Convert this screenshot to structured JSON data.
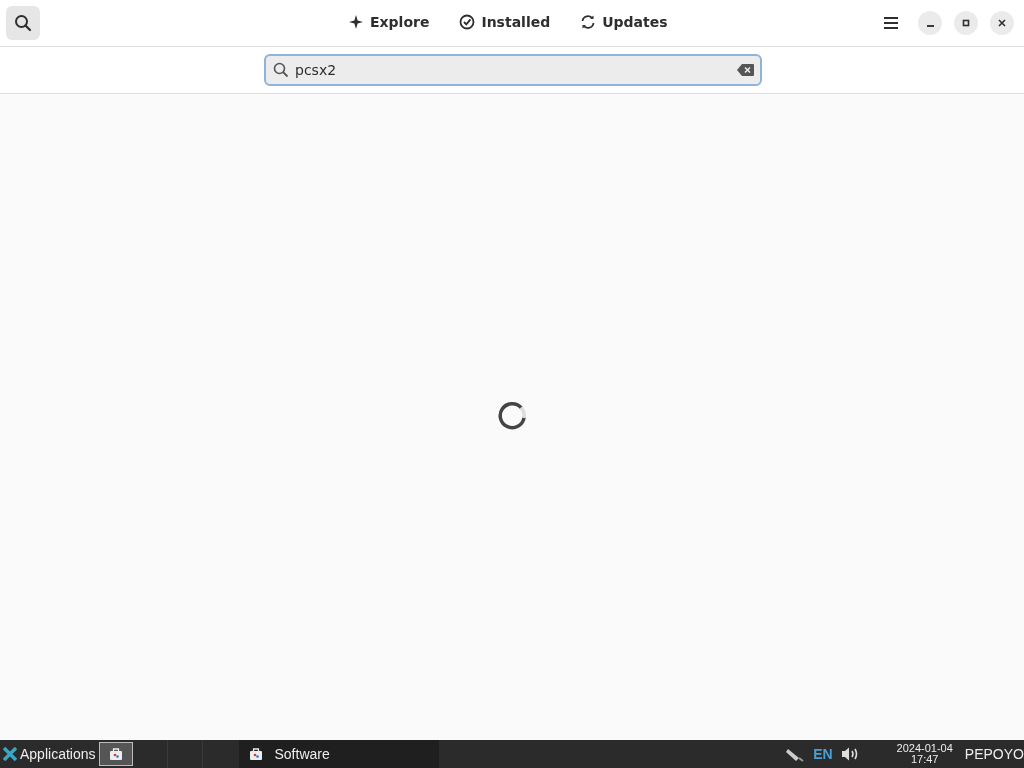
{
  "header": {
    "search_toggle": {
      "on": true
    },
    "tabs": [
      {
        "label": "Explore",
        "selected": false
      },
      {
        "label": "Installed",
        "selected": false
      },
      {
        "label": "Updates",
        "selected": false
      }
    ]
  },
  "search": {
    "value": "pcsx2"
  },
  "taskbar": {
    "menu": {
      "label": "Applications"
    },
    "windows": [
      {
        "label": "Software",
        "selected": true
      }
    ],
    "tray": {
      "language": "EN",
      "date": "2024-01-04",
      "time": "17:47",
      "user": "PEPOYO"
    }
  }
}
